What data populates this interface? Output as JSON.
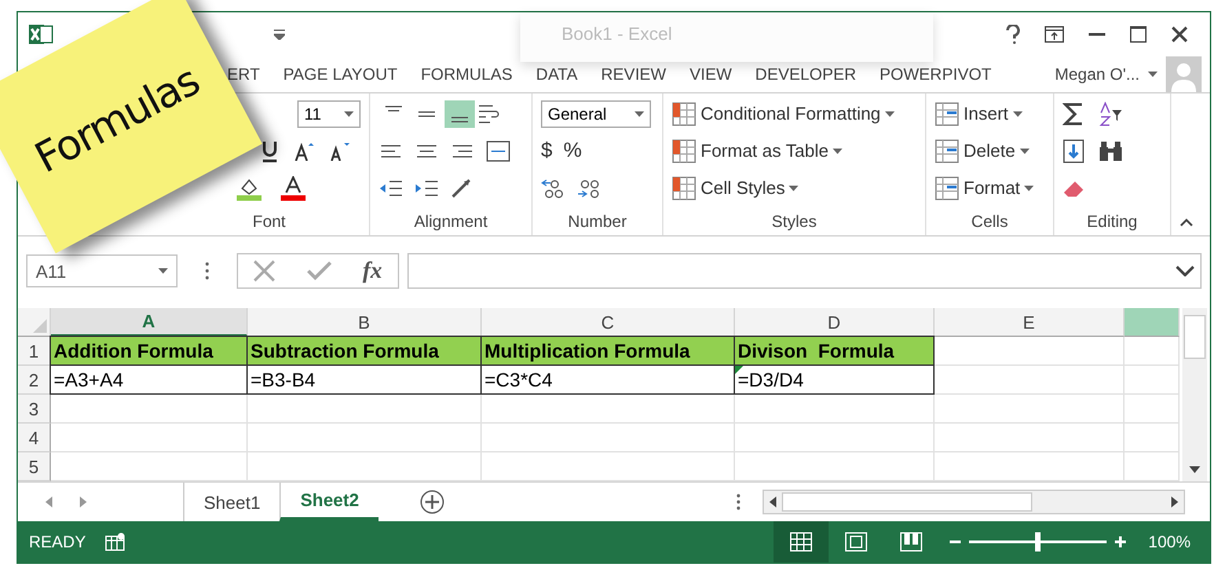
{
  "window": {
    "title": "Book1 - Excel",
    "user": "Megan O'..."
  },
  "sticky_note": {
    "text": "Formulas"
  },
  "ribbon_tabs": [
    {
      "label": "ERT",
      "selected": false
    },
    {
      "label": "PAGE LAYOUT",
      "selected": false
    },
    {
      "label": "FORMULAS",
      "selected": false
    },
    {
      "label": "DATA",
      "selected": false
    },
    {
      "label": "REVIEW",
      "selected": false
    },
    {
      "label": "VIEW",
      "selected": false
    },
    {
      "label": "DEVELOPER",
      "selected": false
    },
    {
      "label": "POWERPIVOT",
      "selected": false
    }
  ],
  "ribbon": {
    "font": {
      "label": "Font",
      "size": "11"
    },
    "alignment": {
      "label": "Alignment",
      "vertical": [
        {
          "selected": false
        },
        {
          "selected": false
        },
        {
          "selected": true
        }
      ]
    },
    "number": {
      "label": "Number",
      "format": "General",
      "currency": "$",
      "percent": "%"
    },
    "styles": {
      "label": "Styles",
      "items": [
        "Conditional Formatting",
        "Format as Table",
        "Cell Styles"
      ]
    },
    "cells": {
      "label": "Cells",
      "items": [
        "Insert",
        "Delete",
        "Format"
      ]
    },
    "editing": {
      "label": "Editing"
    }
  },
  "formula_bar": {
    "name_box": "A11",
    "function_label": "fx"
  },
  "sheet": {
    "columns": [
      {
        "label": "A",
        "selected": true
      },
      {
        "label": "B",
        "selected": false
      },
      {
        "label": "C",
        "selected": false
      },
      {
        "label": "D",
        "selected": false
      },
      {
        "label": "E",
        "selected": false
      }
    ],
    "rows": [
      {
        "number": "1",
        "cells": [
          {
            "kind": "header",
            "text": "Addition Formula"
          },
          {
            "kind": "header",
            "text": "Subtraction Formula"
          },
          {
            "kind": "header",
            "text": "Multiplication Formula"
          },
          {
            "kind": "header",
            "text": "Divison  Formula"
          }
        ]
      },
      {
        "number": "2",
        "cells": [
          {
            "kind": "formula",
            "text": "=A3+A4"
          },
          {
            "kind": "formula",
            "text": "=B3-B4"
          },
          {
            "kind": "formula",
            "text": "=C3*C4"
          },
          {
            "kind": "formula",
            "text": "=D3/D4",
            "warning": true
          }
        ]
      },
      {
        "number": "3",
        "cells": []
      },
      {
        "number": "4",
        "cells": []
      },
      {
        "number": "5",
        "cells": []
      }
    ]
  },
  "sheet_tabs": [
    {
      "label": "Sheet1",
      "selected": false
    },
    {
      "label": "Sheet2",
      "selected": true
    }
  ],
  "status_bar": {
    "status": "READY",
    "zoom": "100%",
    "zoom_slider": {
      "level": 0.5
    }
  }
}
